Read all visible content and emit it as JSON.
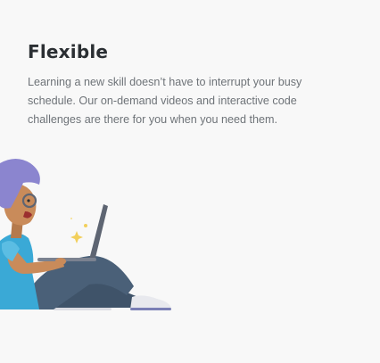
{
  "feature": {
    "title": "Flexible",
    "description": "Learning a new skill doesn’t have to interrupt your busy schedule. Our on-demand videos and interactive code challenges are there for you when you need them."
  },
  "illustration": {
    "icon": "person-with-laptop-illustration",
    "colors": {
      "hair": "#8b85cf",
      "skin": "#c98b5a",
      "shirt": "#3aa9d6",
      "pants": "#4a6078",
      "laptop": "#5e6572",
      "shoe": "#e8e9ee",
      "sparkle": "#f2cf5b",
      "ground": "#dcdde3"
    }
  }
}
